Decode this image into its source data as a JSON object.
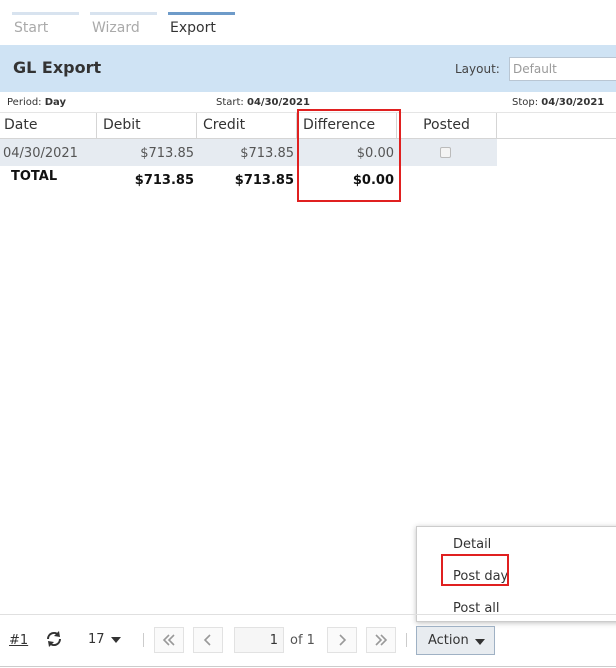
{
  "tabs": [
    {
      "label": "Start",
      "active": false
    },
    {
      "label": "Wizard",
      "active": false
    },
    {
      "label": "Export",
      "active": true
    }
  ],
  "header": {
    "title": "GL Export",
    "layout_label": "Layout:",
    "layout_placeholder": "Default"
  },
  "info": {
    "period_label": "Period:",
    "period_value": "Day",
    "start_label": "Start:",
    "start_value": "04/30/2021",
    "stop_label": "Stop:",
    "stop_value": "04/30/2021"
  },
  "table": {
    "columns": [
      "Date",
      "Debit",
      "Credit",
      "Difference",
      "Posted"
    ],
    "rows": [
      {
        "date": "04/30/2021",
        "debit": "$713.85",
        "credit": "$713.85",
        "difference": "$0.00",
        "posted": false
      }
    ],
    "total": {
      "label": "TOTAL",
      "debit": "$713.85",
      "credit": "$713.85",
      "difference": "$0.00"
    }
  },
  "action_menu": {
    "items": [
      "Detail",
      "Post day",
      "Post all"
    ]
  },
  "footer": {
    "link": "#1",
    "page_size": "17",
    "current_page": "1",
    "of_text": "of 1",
    "action_label": "Action"
  },
  "colors": {
    "header_bg": "#cfe3f4",
    "active_tab_bar": "#6e9bc9",
    "highlight": "#e02020",
    "row_bg": "#e6ebf1"
  }
}
